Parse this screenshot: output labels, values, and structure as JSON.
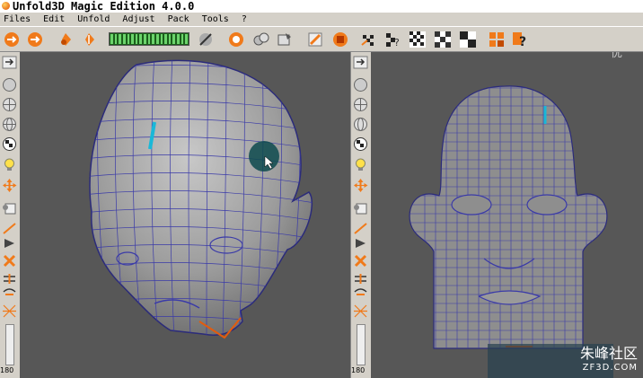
{
  "window": {
    "title": "Unfold3D Magic Edition 4.0.0"
  },
  "menu": [
    "Files",
    "Edit",
    "Unfold",
    "Adjust",
    "Pack",
    "Tools",
    "?"
  ],
  "sidebar": {
    "angle_label": "180"
  },
  "watermark": {
    "text": "朱峰社区",
    "url": "ZF3D.COM",
    "corner": "you 优"
  },
  "colors": {
    "viewport": "#575757",
    "mesh": "#3a3aa8",
    "seam": "#19b8d8",
    "accent": "#e35b0e"
  }
}
